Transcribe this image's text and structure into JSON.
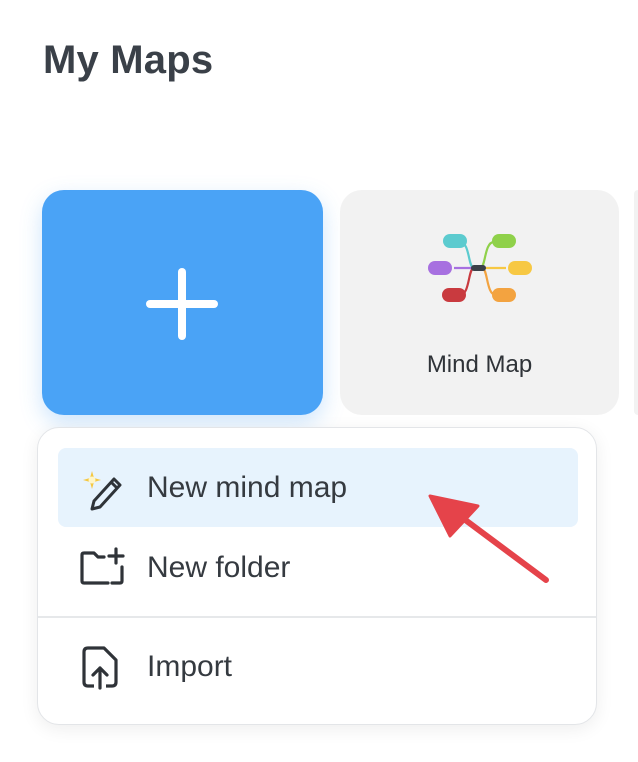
{
  "header": {
    "title": "My Maps"
  },
  "cards": {
    "new": {
      "icon": "plus-icon",
      "color": "#4aa3f6"
    },
    "template": {
      "label": "Mind Map",
      "icon": "mind-map-thumbnail-icon",
      "background": "#f2f2f2"
    }
  },
  "menu": {
    "items": [
      {
        "label": "New mind map",
        "icon": "magic-pencil-icon",
        "active": true
      },
      {
        "label": "New folder",
        "icon": "new-folder-icon",
        "active": false
      },
      {
        "label": "Import",
        "icon": "import-file-icon",
        "active": false
      }
    ],
    "active_background": "#e7f3fd"
  },
  "annotation": {
    "icon": "red-arrow-icon",
    "color": "#e5434a"
  }
}
